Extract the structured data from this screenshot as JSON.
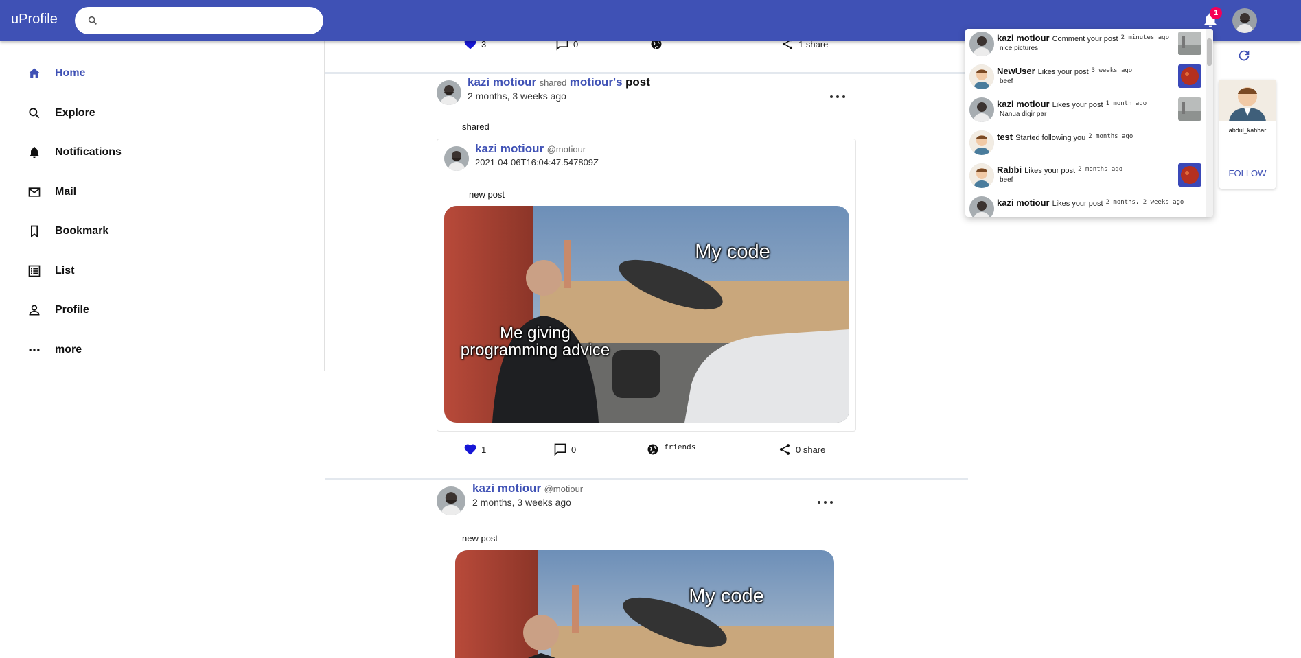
{
  "app": {
    "title": "uProfile",
    "accent": "#3f51b5"
  },
  "search": {
    "placeholder": ""
  },
  "header": {
    "notification_count": "1"
  },
  "sidebar": {
    "items": [
      {
        "label": "Home",
        "icon": "home-icon",
        "active": true
      },
      {
        "label": "Explore",
        "icon": "search-icon"
      },
      {
        "label": "Notifications",
        "icon": "bell-icon"
      },
      {
        "label": "Mail",
        "icon": "mail-icon"
      },
      {
        "label": "Bookmark",
        "icon": "bookmark-icon"
      },
      {
        "label": "List",
        "icon": "list-icon"
      },
      {
        "label": "Profile",
        "icon": "person-icon"
      },
      {
        "label": "more",
        "icon": "more-horiz-icon"
      }
    ]
  },
  "feed": {
    "top_actions": {
      "likes": "3",
      "comments": "0",
      "privacy": "public",
      "shares": "1 share"
    },
    "post1": {
      "user": "kazi motiour",
      "shared_word": "shared",
      "owner": "motiour's",
      "post_word": "post",
      "time": "2 months, 3 weeks ago",
      "caption": "shared",
      "inner": {
        "user": "kazi motiour",
        "handle": "@motiour",
        "time": "2021-04-06T16:04:47.547809Z",
        "text": "new post",
        "meme_top": "My code",
        "meme_bottom": "Me giving programming advice"
      },
      "actions": {
        "likes": "1",
        "comments": "0",
        "privacy": "friends",
        "shares": "0 share"
      }
    },
    "post2": {
      "user": "kazi motiour",
      "handle": "@motiour",
      "time": "2 months, 3 weeks ago",
      "text": "new post",
      "meme_top": "My code"
    }
  },
  "notifications": [
    {
      "user": "kazi motiour",
      "verb": "Comment your post",
      "time": "2 minutes ago",
      "sub": "nice pictures",
      "thumb": "street"
    },
    {
      "user": "NewUser",
      "verb": "Likes your post",
      "time": "3 weeks ago",
      "sub": "beef",
      "thumb": "food"
    },
    {
      "user": "kazi motiour",
      "verb": "Likes your post",
      "time": "1 month ago",
      "sub": "Nanua digir par",
      "thumb": "street"
    },
    {
      "user": "test",
      "verb": "Started following you",
      "time": "2 months ago",
      "sub": "",
      "thumb": ""
    },
    {
      "user": "Rabbi",
      "verb": "Likes your post",
      "time": "2 months ago",
      "sub": "beef",
      "thumb": "food"
    },
    {
      "user": "kazi motiour",
      "verb": "Likes your post",
      "time": "2 months, 2 weeks ago",
      "sub": "",
      "thumb": ""
    }
  ],
  "suggestion": {
    "username": "abdul_kahhar",
    "follow_label": "FOLLOW"
  }
}
